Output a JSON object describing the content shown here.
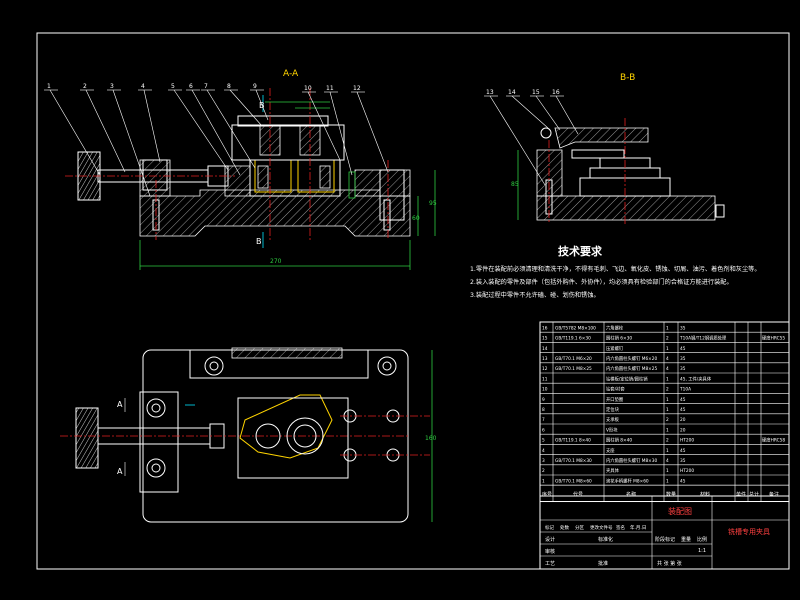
{
  "section_labels": {
    "aa": "A-A",
    "bb": "B-B",
    "b_left": "B",
    "b_top": "B",
    "a_left1": "A",
    "a_left2": "A"
  },
  "balloons_main": [
    "1",
    "2",
    "3",
    "4",
    "5",
    "6",
    "7",
    "8",
    "9",
    "10",
    "11",
    "12"
  ],
  "balloons_bb": [
    "13",
    "14",
    "15",
    "16"
  ],
  "tech_req": {
    "title": "技术要求",
    "lines": [
      "1.零件在装配前必须清理和清洗干净，不得有毛刺、飞边、氧化皮、锈蚀、切屑、油污、着色剂和灰尘等。",
      "2.装入装配的零件及部件（包括外购件、外协件），均必须具有检验部门的合格证方能进行装配。",
      "3.装配过程中零件不允许磕、碰、划伤和锈蚀。"
    ]
  },
  "parts_table": {
    "rows": [
      {
        "no": "16",
        "code": "GB/T5782 M8×100",
        "name": "六角螺栓",
        "qty": "1",
        "material": "35",
        "note": ""
      },
      {
        "no": "15",
        "code": "GB/T119.1 6×30",
        "name": "圆柱销 6×30",
        "qty": "2",
        "material": "T10A钢/T12钢调质处理",
        "note": "硬度HRC55"
      },
      {
        "no": "14",
        "code": "",
        "name": "压紧螺钉",
        "qty": "1",
        "material": "45",
        "note": ""
      },
      {
        "no": "13",
        "code": "GB/T70.1 M6×20",
        "name": "内六角圆柱头螺钉 M6×20",
        "qty": "4",
        "material": "35",
        "note": ""
      },
      {
        "no": "12",
        "code": "GB/T70.1 M8×25",
        "name": "内六角圆柱头螺钉 M8×25",
        "qty": "4",
        "material": "35",
        "note": ""
      },
      {
        "no": "11",
        "code": "",
        "name": "钻模板/定位销/圆柱销",
        "qty": "1",
        "material": "45, 工件/夹具体",
        "note": ""
      },
      {
        "no": "10",
        "code": "",
        "name": "钻套/衬套",
        "qty": "2",
        "material": "T10A",
        "note": ""
      },
      {
        "no": "9",
        "code": "",
        "name": "开口垫圈",
        "qty": "1",
        "material": "45",
        "note": ""
      },
      {
        "no": "8",
        "code": "",
        "name": "定位块",
        "qty": "1",
        "material": "45",
        "note": ""
      },
      {
        "no": "7",
        "code": "",
        "name": "支承板",
        "qty": "2",
        "material": "20",
        "note": ""
      },
      {
        "no": "6",
        "code": "",
        "name": "V形块",
        "qty": "1",
        "material": "20",
        "note": ""
      },
      {
        "no": "5",
        "code": "GB/T119.1 8×40",
        "name": "圆柱销 8×40",
        "qty": "2",
        "material": "HT200",
        "note": "硬度HRC58"
      },
      {
        "no": "4",
        "code": "",
        "name": "支座",
        "qty": "1",
        "material": "45",
        "note": ""
      },
      {
        "no": "3",
        "code": "GB/T70.1 M8×30",
        "name": "内六角圆柱头螺钉 M8×30",
        "qty": "4",
        "material": "35",
        "note": ""
      },
      {
        "no": "2",
        "code": "",
        "name": "夹具体",
        "qty": "1",
        "material": "HT200",
        "note": ""
      },
      {
        "no": "1",
        "code": "GB/T70.1 M8×60",
        "name": "滚花手柄螺杆 M8×60",
        "qty": "1",
        "material": "45",
        "note": ""
      }
    ],
    "header": {
      "no": "序号",
      "code": "代号",
      "name": "名称",
      "qty": "数量",
      "material": "材料",
      "unit_w": "单件",
      "total_w": "总计",
      "weight": "重量",
      "note": "备注"
    }
  },
  "title_block": {
    "drawing_name": "装配图",
    "product_name": "铣槽专用夹具",
    "labels": [
      "标记",
      "处数",
      "分区",
      "更改文件号",
      "签名",
      "年.月.日"
    ],
    "design": "设计",
    "standard": "标准化",
    "review": "审核",
    "process": "工艺",
    "approve": "批准",
    "stage": "阶段标记",
    "weight": "重量",
    "scale": "比例",
    "scale_value": "1:1",
    "sheets": "共  张  第  张"
  },
  "dims": {
    "total_len": "270",
    "height_right": "95",
    "height_right2": "60",
    "plan_height": "160",
    "bb_height": "85"
  }
}
